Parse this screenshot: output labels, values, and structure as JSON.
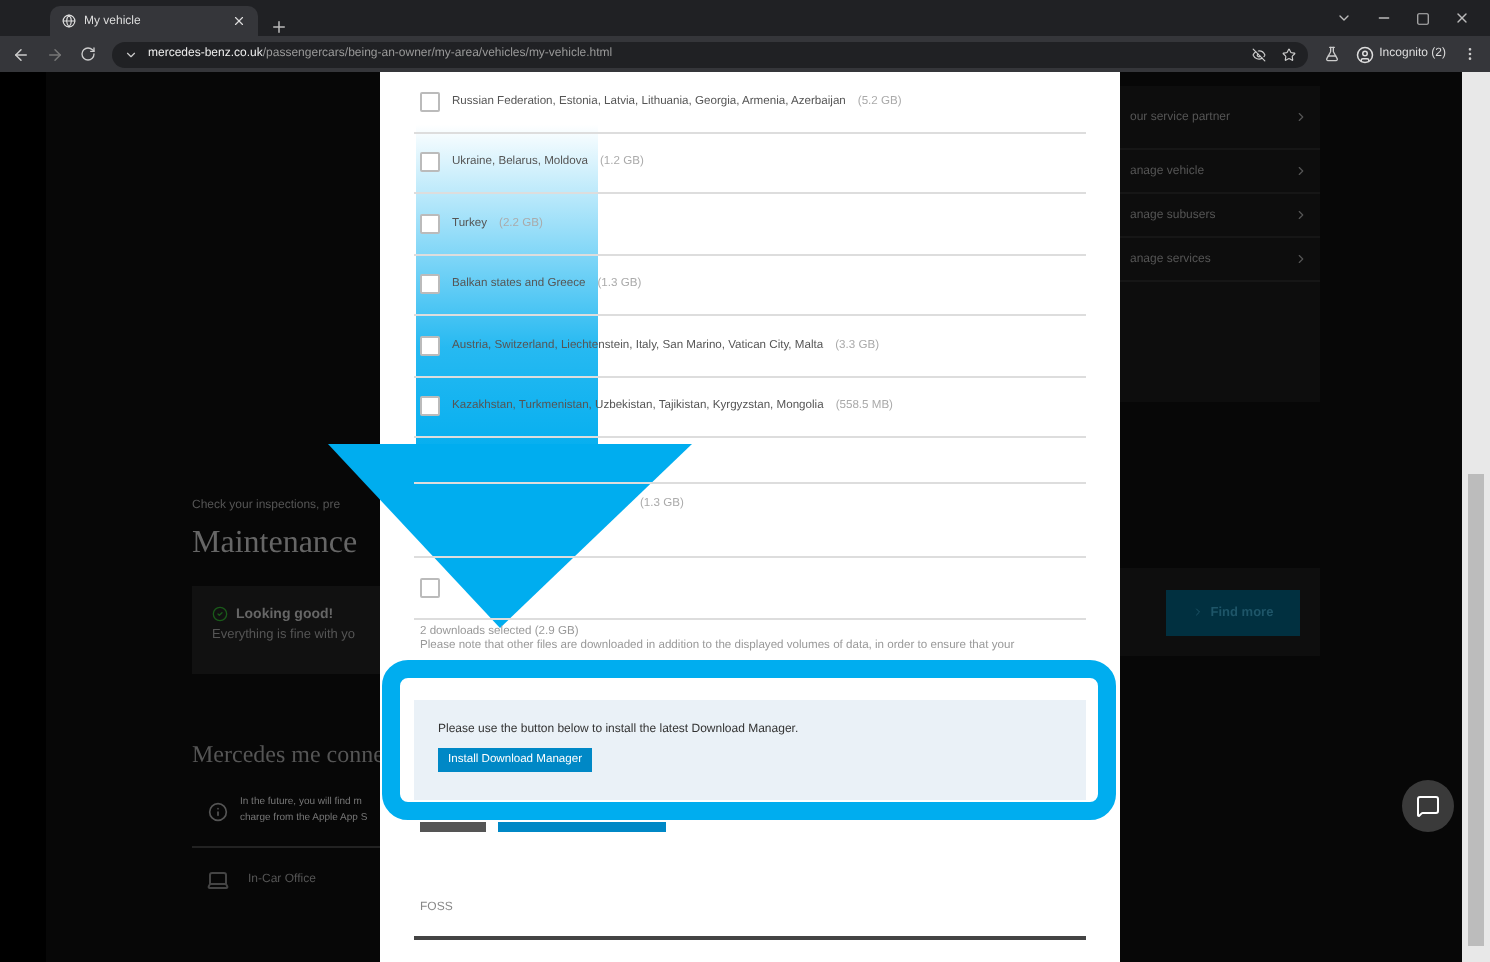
{
  "browser": {
    "tab_title": "My vehicle",
    "url_host": "mercedes-benz.co.uk",
    "url_path": "/passengercars/being-an-owner/my-area/vehicles/my-vehicle.html",
    "profile": "Incognito (2)"
  },
  "page": {
    "intro": "Check your inspections, pre",
    "heading": "Maintenance",
    "status_title": "Looking good!",
    "status_text": "Everything is fine with yo",
    "find_more": "Find more",
    "section_heading": "Mercedes me conne",
    "info_lines": [
      "In the future, you will find m",
      "charge from the Apple App S"
    ],
    "app_item": "In-Car Office",
    "menu": [
      "our service partner",
      "anage vehicle",
      "anage subusers",
      "anage services"
    ]
  },
  "dialog": {
    "regions": [
      {
        "label": "Russian Federation, Estonia, Latvia, Lithuania, Georgia, Armenia, Azerbaijan",
        "size": "(5.2 GB)",
        "checked": false
      },
      {
        "label": "Ukraine, Belarus, Moldova",
        "size": "(1.2 GB)",
        "checked": false
      },
      {
        "label": "Turkey",
        "size": "(2.2 GB)",
        "checked": false
      },
      {
        "label": "Balkan states and Greece",
        "size": "(1.3 GB)",
        "checked": false
      },
      {
        "label": "Austria, Switzerland, Liechtenstein, Italy, San Marino, Vatican City, Malta",
        "size": "(3.3 GB)",
        "checked": false
      },
      {
        "label": "Kazakhstan, Turkmenistan, Uzbekistan, Tajikistan, Kyrgyzstan, Mongolia",
        "size": "(558.5 MB)",
        "checked": false
      },
      {
        "size": "(1.3 GB)"
      },
      {
        "checked": false
      }
    ],
    "summary": "2 downloads selected (2.9 GB)",
    "note": "Please note that other files are downloaded in addition to the displayed volumes of data, in order to ensure that your",
    "install_prompt": "Please use the button below to install the latest Download Manager.",
    "install_button": "Install Download Manager",
    "field_label": "FOSS"
  }
}
